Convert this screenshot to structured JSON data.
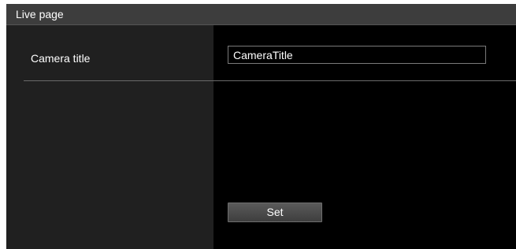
{
  "section": {
    "title": "Live page"
  },
  "camera_title": {
    "label": "Camera title",
    "value": "CameraTitle"
  },
  "actions": {
    "set_label": "Set"
  }
}
